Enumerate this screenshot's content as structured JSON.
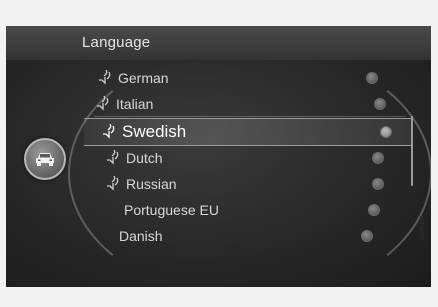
{
  "page_title": "Language",
  "car_button_icon": "car-icon",
  "image_code": "G049104",
  "languages": [
    {
      "label": "German",
      "voice": true,
      "selected": false
    },
    {
      "label": "Italian",
      "voice": true,
      "selected": false
    },
    {
      "label": "Swedish",
      "voice": true,
      "selected": true
    },
    {
      "label": "Dutch",
      "voice": true,
      "selected": false
    },
    {
      "label": "Russian",
      "voice": true,
      "selected": false
    },
    {
      "label": "Portuguese EU",
      "voice": false,
      "selected": false
    },
    {
      "label": "Danish",
      "voice": false,
      "selected": false
    }
  ]
}
